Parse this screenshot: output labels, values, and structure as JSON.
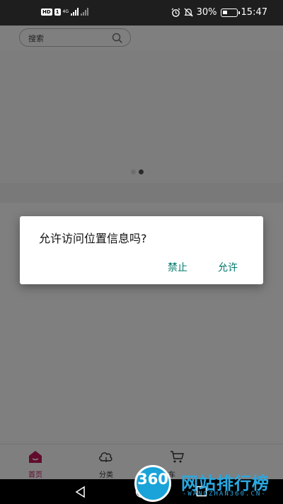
{
  "status_bar": {
    "left_badge": "HD",
    "sim_slot": "1",
    "network": "4G",
    "battery_percent": "30%",
    "time": "15:47",
    "icons": [
      "alarm-icon",
      "mute-icon",
      "battery-charging-icon"
    ]
  },
  "search": {
    "placeholder": "搜索",
    "icon": "search-icon"
  },
  "carousel": {
    "slides": 2,
    "active_index": 1
  },
  "tabs": [
    {
      "label": "首页",
      "icon": "home-icon",
      "active": true
    },
    {
      "label": "分类",
      "icon": "category-icon",
      "active": false
    },
    {
      "label": "购物车",
      "icon": "cart-icon",
      "active": false
    }
  ],
  "dialog": {
    "title": "允许访问位置信息吗?",
    "deny_label": "禁止",
    "allow_label": "允许"
  },
  "watermark": {
    "number": "360",
    "title": "网站排行榜",
    "subtitle": "-WANGZHAN360.CN-"
  },
  "colors": {
    "accent": "#00796b",
    "tab_active": "#c2185b",
    "watermark": "#2aa8e0"
  }
}
